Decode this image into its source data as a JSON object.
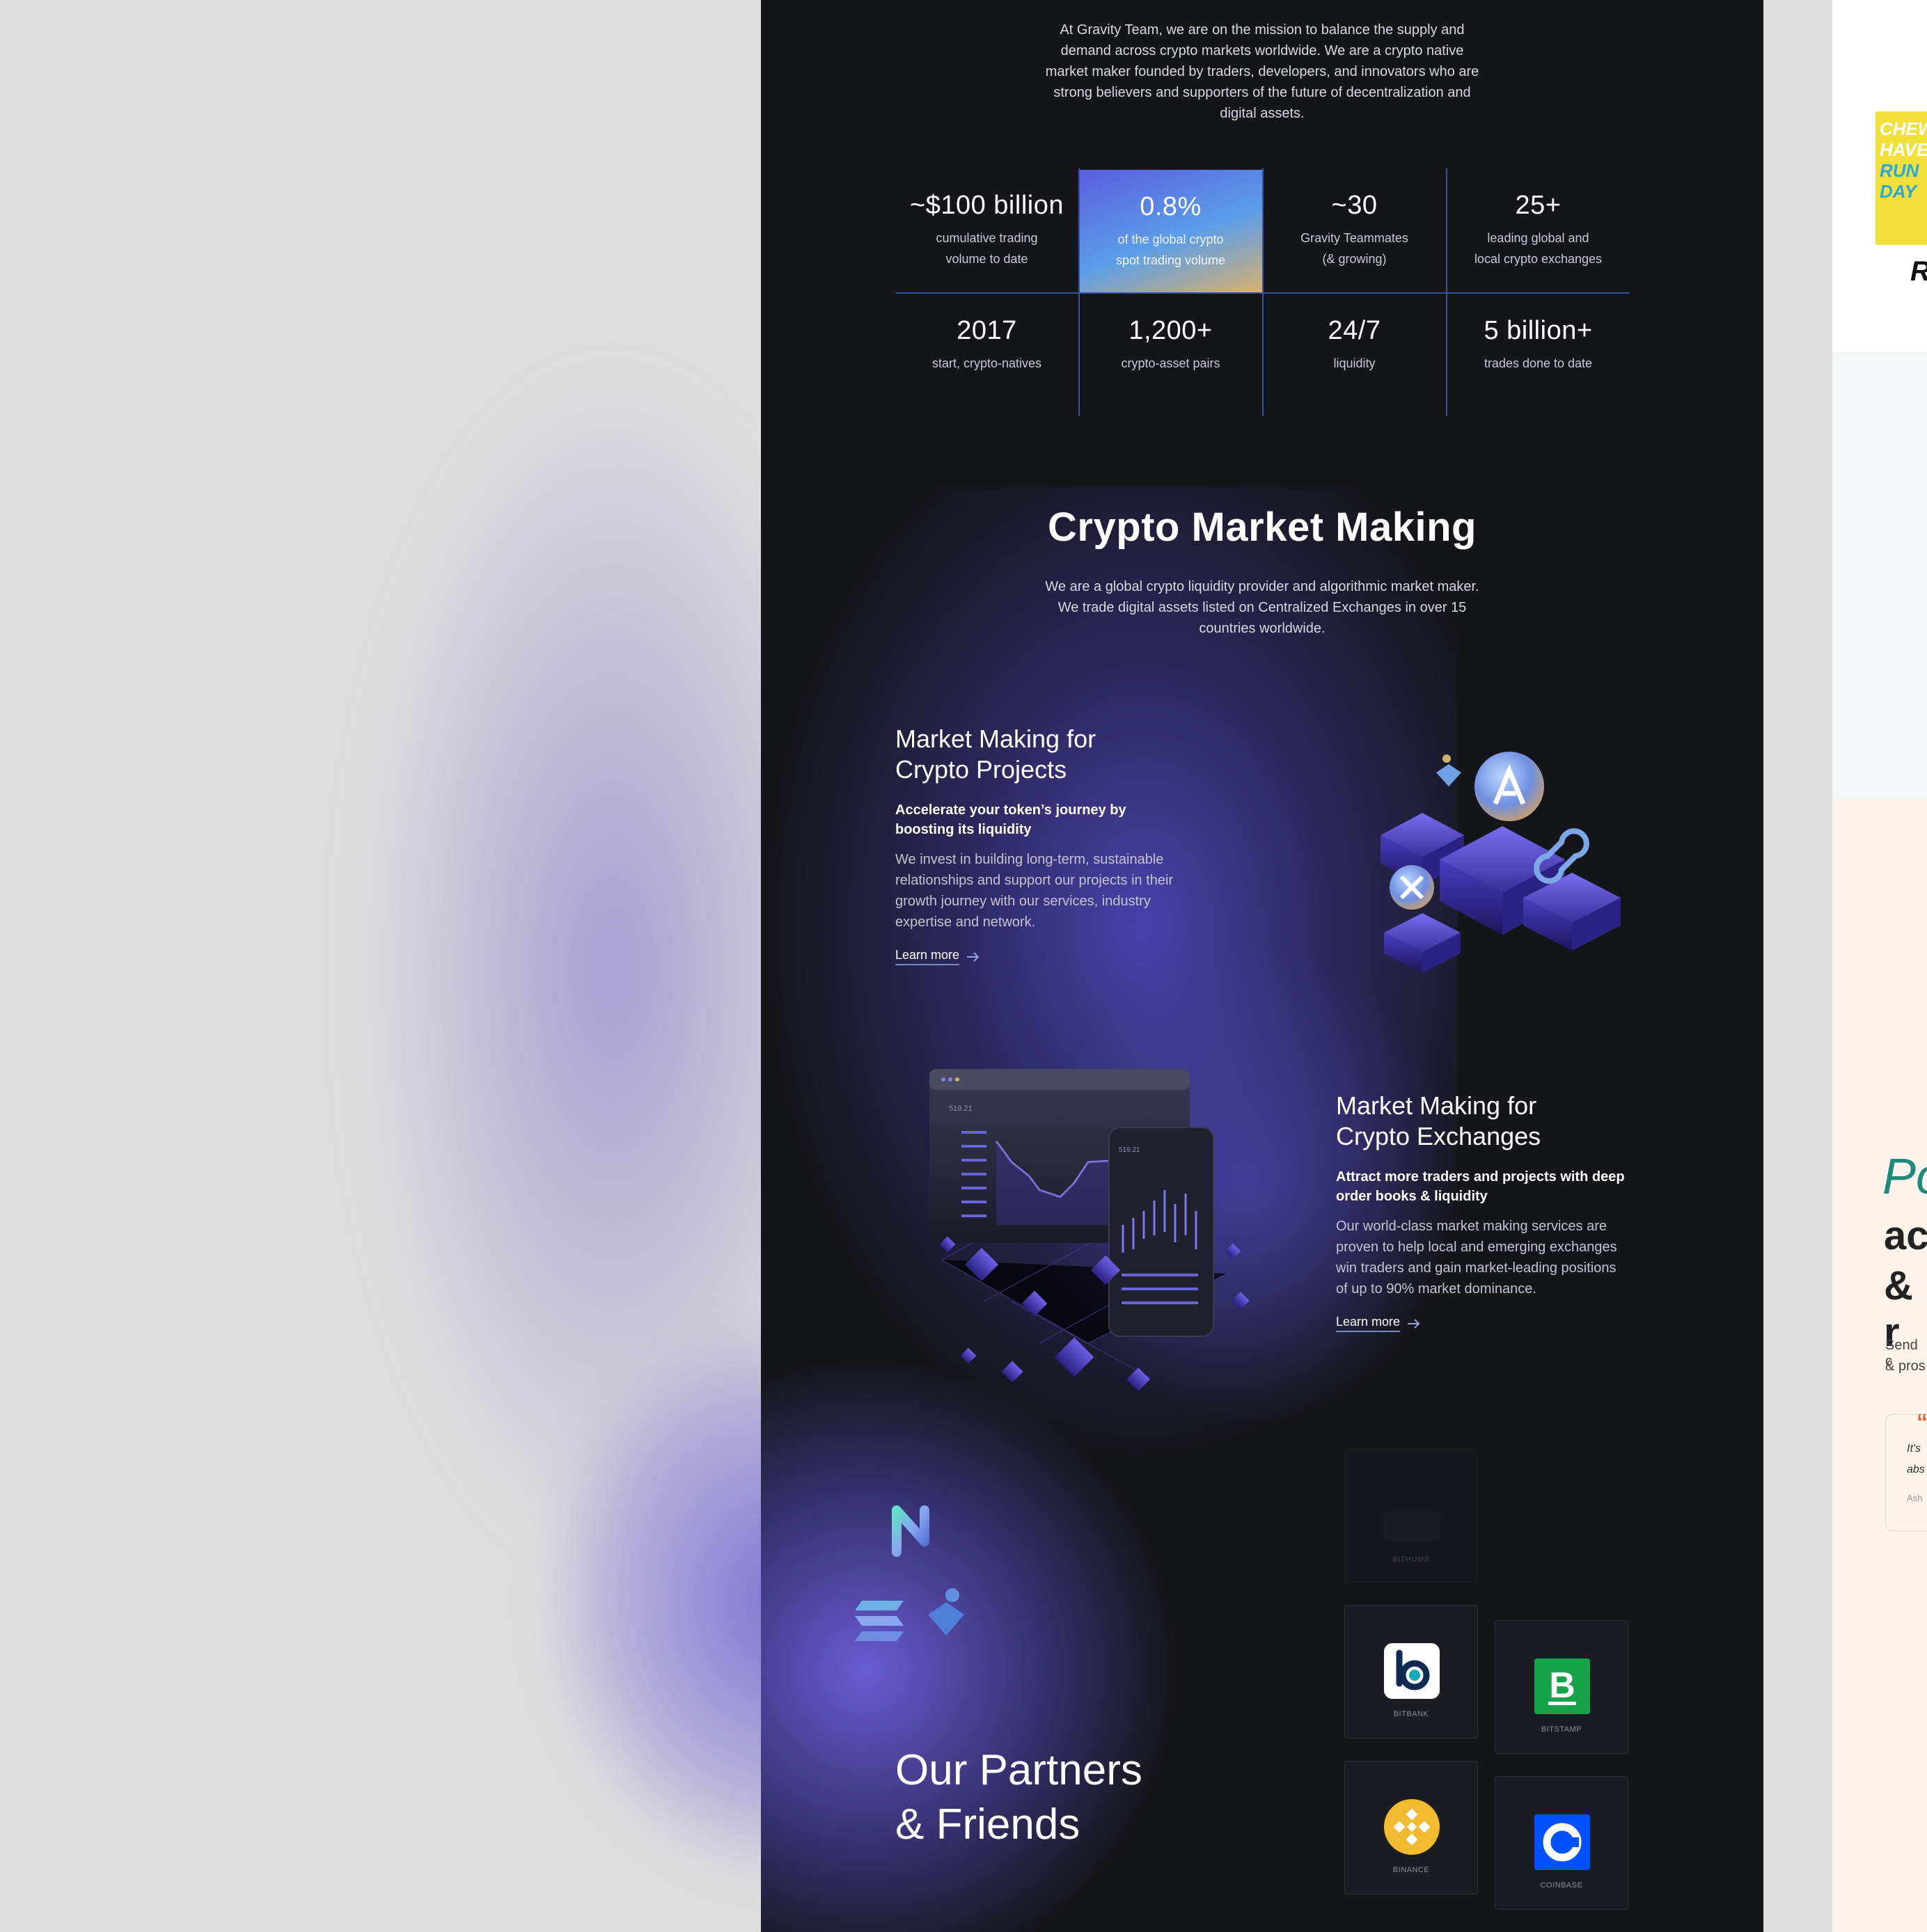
{
  "intro": {
    "text": "At Gravity Team, we are on the mission to balance the supply and demand across crypto markets worldwide. We are a crypto native market maker founded by traders, developers, and innovators who are strong believers and supporters of the future of decentralization and digital assets."
  },
  "stats": [
    {
      "value": "~$100 billion",
      "label1": "cumulative trading",
      "label2": "volume to date"
    },
    {
      "value": "0.8%",
      "label1": "of the global crypto",
      "label2": "spot trading volume"
    },
    {
      "value": "~30",
      "label1": "Gravity Teammates",
      "label2": "(& growing)"
    },
    {
      "value": "25+",
      "label1": "leading global and",
      "label2": "local crypto exchanges"
    },
    {
      "value": "2017",
      "label1": "start, crypto-natives",
      "label2": ""
    },
    {
      "value": "1,200+",
      "label1": "crypto-asset pairs",
      "label2": ""
    },
    {
      "value": "24/7",
      "label1": "liquidity",
      "label2": ""
    },
    {
      "value": "5 billion+",
      "label1": "trades done to date",
      "label2": ""
    }
  ],
  "market_making": {
    "title": "Crypto Market Making",
    "description": "We are a global crypto liquidity provider and algorithmic market maker. We trade digital assets listed on Centralized Exchanges in over 15 countries worldwide."
  },
  "projects": {
    "title_line1": "Market Making for",
    "title_line2": "Crypto Projects",
    "lead": "Accelerate your token’s journey by boosting its liquidity",
    "body": "We invest in building long-term, sustainable relationships and support our projects in their growth journey with our services, industry expertise and network.",
    "link": "Learn more"
  },
  "exchanges": {
    "title_line1": "Market Making for",
    "title_line2": "Crypto Exchanges",
    "lead": "Attract more traders and projects with deep order books & liquidity",
    "body": "Our world-class market making services are proven to help local and emerging exchanges win traders and gain market-leading positions of up to 90% market dominance.",
    "link": "Learn more",
    "chart_price_1": "519.21",
    "chart_price_2": "519.21"
  },
  "partners": {
    "title_line1": "Our Partners",
    "title_line2": "& Friends",
    "logos": [
      {
        "name": "BITHUMB"
      },
      {
        "name": "BITBANK"
      },
      {
        "name": "BITSTAMP"
      },
      {
        "name": "BINANCE"
      },
      {
        "name": "COINBASE"
      }
    ]
  },
  "right_page": {
    "book_line1": "CHEW",
    "book_line2": "HAVE",
    "book_line3": "RUN",
    "book_line4": "DAY",
    "letter_r": "R",
    "script_text": "Po",
    "heading_line1": "ac",
    "heading_line2": "& r",
    "sub_line1": "Send c",
    "sub_line2": "& pros",
    "quote_line1": "It's",
    "quote_line2": "abs",
    "quote_author": "Ash"
  },
  "colors": {
    "page_bg": "#15161a",
    "accent": "#5b5fe0",
    "divider": "#3d4fa0"
  }
}
